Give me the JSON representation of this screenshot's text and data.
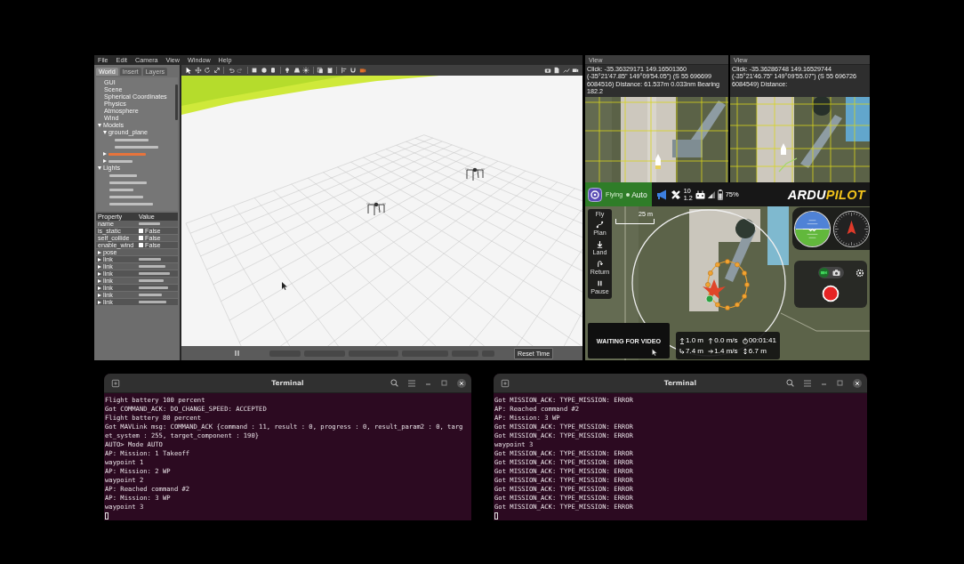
{
  "gazebo": {
    "menu": [
      "File",
      "Edit",
      "Camera",
      "View",
      "Window",
      "Help"
    ],
    "tabs": [
      {
        "label": "World",
        "selected": true
      },
      {
        "label": "Insert",
        "selected": false
      },
      {
        "label": "Layers",
        "selected": false
      }
    ],
    "tree": [
      {
        "kind": "label",
        "label": "GUI",
        "selected": false
      },
      {
        "kind": "label",
        "label": "Scene",
        "selected": false
      },
      {
        "kind": "label",
        "label": "Spherical Coordinates",
        "selected": false
      },
      {
        "kind": "label",
        "label": "Physics",
        "selected": false
      },
      {
        "kind": "label",
        "label": "Atmosphere",
        "selected": false
      },
      {
        "kind": "label",
        "label": "Wind",
        "selected": false
      },
      {
        "kind": "label",
        "label": "Models",
        "selected": false,
        "expanded": true,
        "children": [
          {
            "kind": "label",
            "label": "ground_plane",
            "selected": false,
            "expanded": true,
            "children": [
              {
                "kind": "blurred",
                "selected": false
              },
              {
                "kind": "blurred",
                "selected": false
              }
            ]
          },
          {
            "kind": "blurred",
            "selected": true,
            "expanded": false
          },
          {
            "kind": "blurred",
            "selected": false,
            "expanded": false
          }
        ]
      },
      {
        "kind": "label",
        "label": "Lights",
        "selected": false,
        "expanded": true,
        "children": [
          {
            "kind": "blurred",
            "selected": false
          },
          {
            "kind": "blurred",
            "selected": false
          },
          {
            "kind": "blurred",
            "selected": false
          },
          {
            "kind": "blurred",
            "selected": false
          },
          {
            "kind": "blurred",
            "selected": false
          }
        ]
      }
    ],
    "properties": {
      "columns": [
        "Property",
        "Value"
      ],
      "rows": [
        {
          "kind": "field",
          "name": "name"
        },
        {
          "kind": "checkbox",
          "name": "is_static",
          "checked": false,
          "value": "False"
        },
        {
          "kind": "checkbox",
          "name": "self_collide",
          "checked": false,
          "value": "False"
        },
        {
          "kind": "checkbox",
          "name": "enable_wind",
          "checked": false,
          "value": "False"
        },
        {
          "kind": "group",
          "name": "pose",
          "expanded": false
        },
        {
          "kind": "group_field",
          "name": "link",
          "expanded": false
        },
        {
          "kind": "group_field",
          "name": "link",
          "expanded": false
        },
        {
          "kind": "group_field",
          "name": "link",
          "expanded": false
        },
        {
          "kind": "group_field",
          "name": "link",
          "expanded": false
        },
        {
          "kind": "group_field",
          "name": "link",
          "expanded": false
        },
        {
          "kind": "group_field",
          "name": "link",
          "expanded": false
        },
        {
          "kind": "group_field",
          "name": "link",
          "expanded": false
        }
      ]
    },
    "reset_button": "Reset Time"
  },
  "map_views": [
    {
      "title": "View",
      "text": "Click: -35.36329171 149.16501360 (-35°21'47.85\" 149°09'54.05\") (S 55 696699 6084516) Distance: 61.537m 0.033nm Bearing 182.2"
    },
    {
      "title": "View",
      "text": "Click: -35.36286748 149.16529744 (-35°21'46.75\" 149°09'55.07\") (S 55 696726 6084549) Distance:"
    }
  ],
  "toolbar": {
    "status": "Flying",
    "mode": "Auto",
    "satellites": "10",
    "hdop": "1.2",
    "battery": "75%",
    "logo": [
      "ARDU",
      "PILOT"
    ]
  },
  "fly_view": {
    "toolstrip": {
      "title": "Fly",
      "items": [
        "Plan",
        "Land",
        "Return",
        "Pause"
      ]
    },
    "scale": "25 m",
    "camera_modes": [
      {
        "kind": "video",
        "selected": true
      },
      {
        "kind": "photo",
        "selected": false
      }
    ],
    "video_status": "WAITING FOR VIDEO",
    "telemetry": [
      "1.0 m",
      "0.0 m/s",
      "00:01:41",
      "7.4 m",
      "1.4 m/s",
      "6.7 m"
    ]
  },
  "terminals": [
    {
      "title": "Terminal",
      "lines": [
        "Flight battery 100 percent",
        "Got COMMAND_ACK: DO_CHANGE_SPEED: ACCEPTED",
        "Flight battery 80 percent",
        "Got MAVLink msg: COMMAND_ACK {command : 11, result : 0, progress : 0, result_param2 : 0, targ",
        "et_system : 255, target_component : 190}",
        "AUTO> Mode AUTO",
        "AP: Mission: 1 Takeoff",
        "waypoint 1",
        "AP: Mission: 2 WP",
        "waypoint 2",
        "AP: Reached command #2",
        "AP: Mission: 3 WP",
        "waypoint 3"
      ]
    },
    {
      "title": "Terminal",
      "lines": [
        "Got MISSION_ACK: TYPE_MISSION: ERROR",
        "AP: Reached command #2",
        "AP: Mission: 3 WP",
        "Got MISSION_ACK: TYPE_MISSION: ERROR",
        "Got MISSION_ACK: TYPE_MISSION: ERROR",
        "waypoint 3",
        "Got MISSION_ACK: TYPE_MISSION: ERROR",
        "Got MISSION_ACK: TYPE_MISSION: ERROR",
        "Got MISSION_ACK: TYPE_MISSION: ERROR",
        "Got MISSION_ACK: TYPE_MISSION: ERROR",
        "Got MISSION_ACK: TYPE_MISSION: ERROR",
        "Got MISSION_ACK: TYPE_MISSION: ERROR",
        "Got MISSION_ACK: TYPE_MISSION: ERROR"
      ]
    }
  ]
}
